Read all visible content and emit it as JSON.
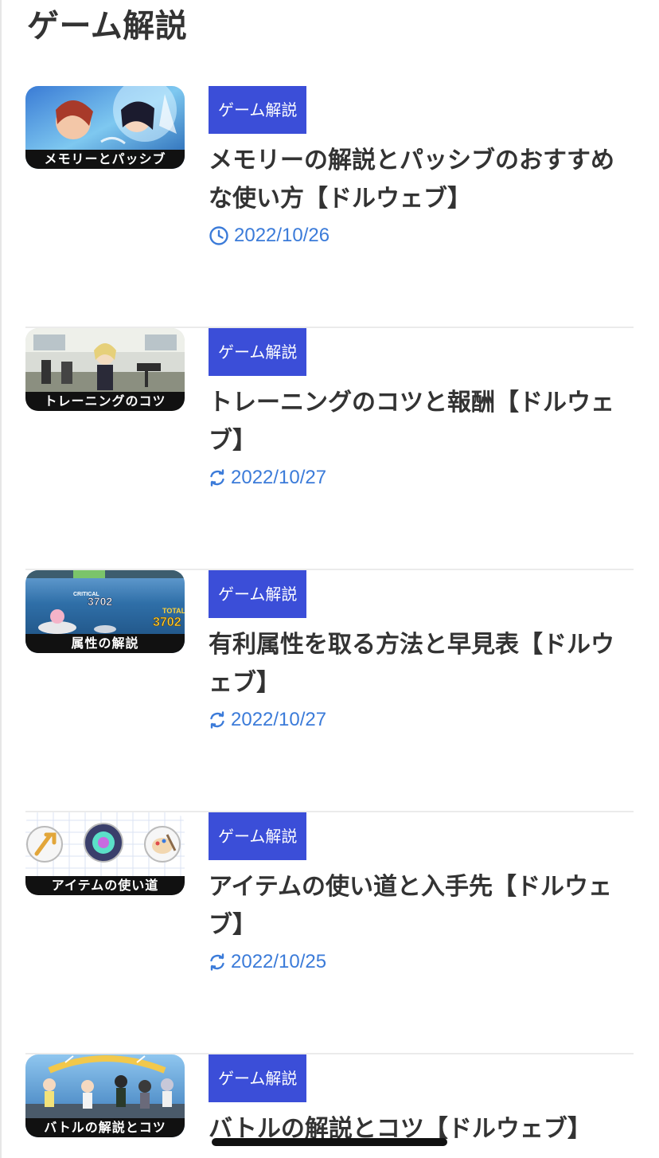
{
  "section": {
    "title": "ゲーム解説"
  },
  "articles": [
    {
      "thumb_caption": "メモリーとパッシブ",
      "category": "ゲーム解説",
      "title": "メモリーの解説とパッシブのおすすめな使い方【ドルウェブ】",
      "date": "2022/10/26",
      "date_icon": "clock-icon"
    },
    {
      "thumb_caption": "トレーニングのコツ",
      "category": "ゲーム解説",
      "title": "トレーニングのコツと報酬【ドルウェブ】",
      "date": "2022/10/27",
      "date_icon": "refresh-icon"
    },
    {
      "thumb_caption": "属性の解説",
      "category": "ゲーム解説",
      "title": "有利属性を取る方法と早見表【ドルウェブ】",
      "date": "2022/10/27",
      "date_icon": "refresh-icon",
      "thumb_overlay": {
        "critical_label": "CRITICAL",
        "critical_value": "3702",
        "total_label": "TOTAL",
        "total_value": "3702"
      }
    },
    {
      "thumb_caption": "アイテムの使い道",
      "category": "ゲーム解説",
      "title": "アイテムの使い道と入手先【ドルウェブ】",
      "date": "2022/10/25",
      "date_icon": "refresh-icon"
    },
    {
      "thumb_caption": "バトルの解説とコツ",
      "category": "ゲーム解説",
      "title": "バトルの解説とコツ【ドルウェブ】"
    }
  ],
  "colors": {
    "badge_bg": "#3b4ed8",
    "date_text": "#3b7bd9",
    "title_text": "#333333",
    "divider": "#ebebeb"
  }
}
